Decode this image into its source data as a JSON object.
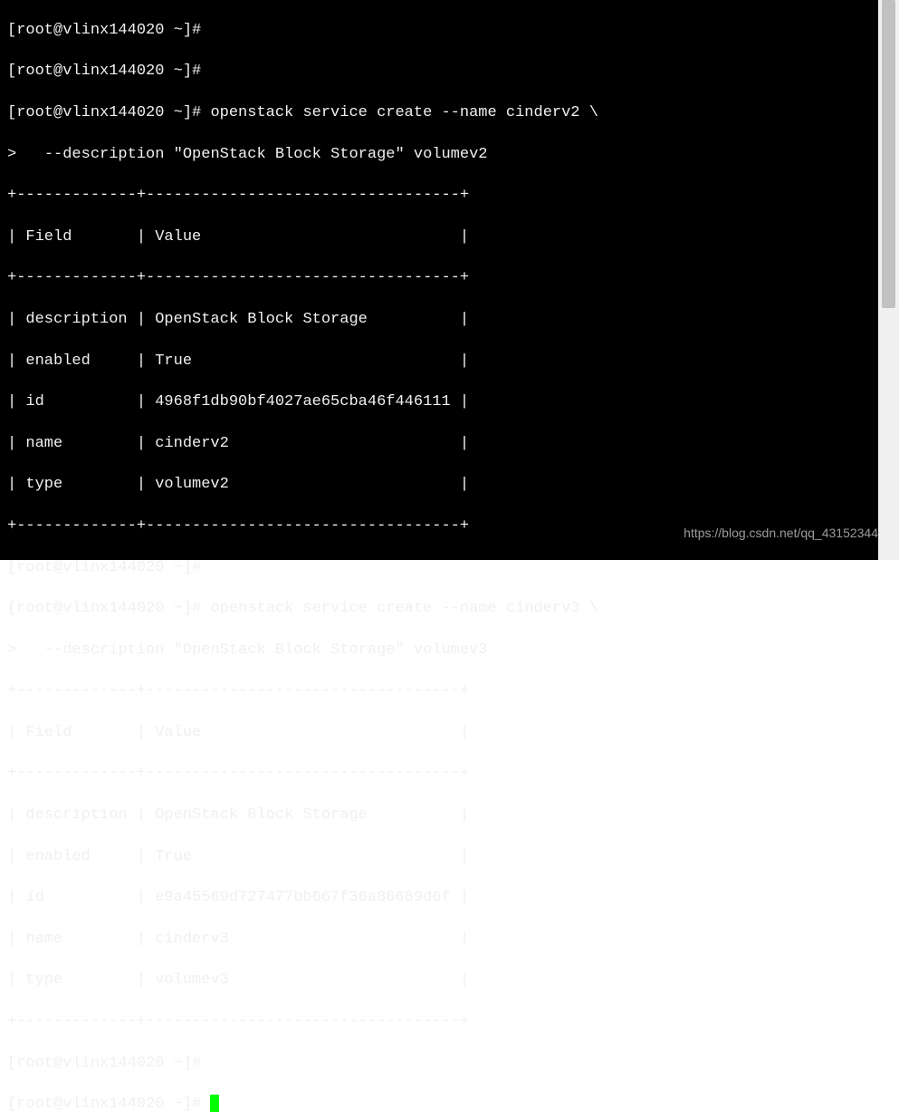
{
  "prompt": "[root@vlinx144020 ~]# ",
  "continuation_prompt": ">   ",
  "commands": {
    "empty1": "",
    "empty2": "",
    "cmd1_line1": "openstack service create --name cinderv2 \\",
    "cmd1_line2": "--description \"OpenStack Block Storage\" volumev2",
    "cmd2_line1": "openstack service create --name cinderv3 \\",
    "cmd2_line2": "--description \"OpenStack Block Storage\" volumev3"
  },
  "table_border": "+-------------+----------------------------------+",
  "table_header": "| Field       | Value                            |",
  "table1": {
    "rows": [
      "| description | OpenStack Block Storage          |",
      "| enabled     | True                             |",
      "| id          | 4968f1db90bf4027ae65cba46f446111 |",
      "| name        | cinderv2                         |",
      "| type        | volumev2                         |"
    ]
  },
  "table2": {
    "rows": [
      "| description | OpenStack Block Storage          |",
      "| enabled     | True                             |",
      "| id          | e9a45569d727477bb667f36a86689d6f |",
      "| name        | cinderv3                         |",
      "| type        | volumev3                         |"
    ]
  },
  "watermark": "https://blog.csdn.net/qq_43152344",
  "chart_data": [
    {
      "type": "table",
      "title": "openstack service create cinderv2",
      "columns": [
        "Field",
        "Value"
      ],
      "rows": [
        [
          "description",
          "OpenStack Block Storage"
        ],
        [
          "enabled",
          "True"
        ],
        [
          "id",
          "4968f1db90bf4027ae65cba46f446111"
        ],
        [
          "name",
          "cinderv2"
        ],
        [
          "type",
          "volumev2"
        ]
      ]
    },
    {
      "type": "table",
      "title": "openstack service create cinderv3",
      "columns": [
        "Field",
        "Value"
      ],
      "rows": [
        [
          "description",
          "OpenStack Block Storage"
        ],
        [
          "enabled",
          "True"
        ],
        [
          "id",
          "e9a45569d727477bb667f36a86689d6f"
        ],
        [
          "name",
          "cinderv3"
        ],
        [
          "type",
          "volumev3"
        ]
      ]
    }
  ]
}
